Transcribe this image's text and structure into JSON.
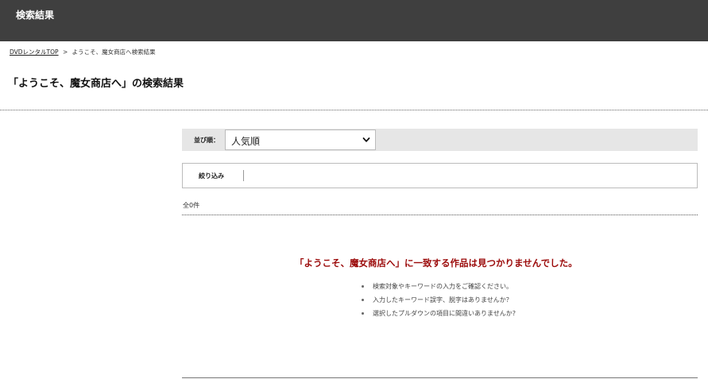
{
  "header": {
    "title": "検索結果",
    "bg_color": "#3f3f3f"
  },
  "breadcrumb": {
    "home_label": "DVDレンタルTOP",
    "separator": ">",
    "current": "ようこそ、魔女商店へ検索結果"
  },
  "page_title": "「ようこそ、魔女商店へ」の検索結果",
  "sort": {
    "label": "並び順：",
    "selected": "人気順",
    "chevron_icon": "chevron-down-icon"
  },
  "filter": {
    "label": "絞り込み"
  },
  "results": {
    "count_text": "全0件",
    "no_result_message": "「ようこそ、魔女商店へ」に一致する作品は見つかりませんでした。",
    "no_result_color": "#9b0a0a",
    "tips": [
      "検索対象やキーワードの入力をご確認ください。",
      "入力したキーワード誤字、脱字はありませんか？",
      "選択したプルダウンの項目に間違いありませんか?"
    ]
  }
}
